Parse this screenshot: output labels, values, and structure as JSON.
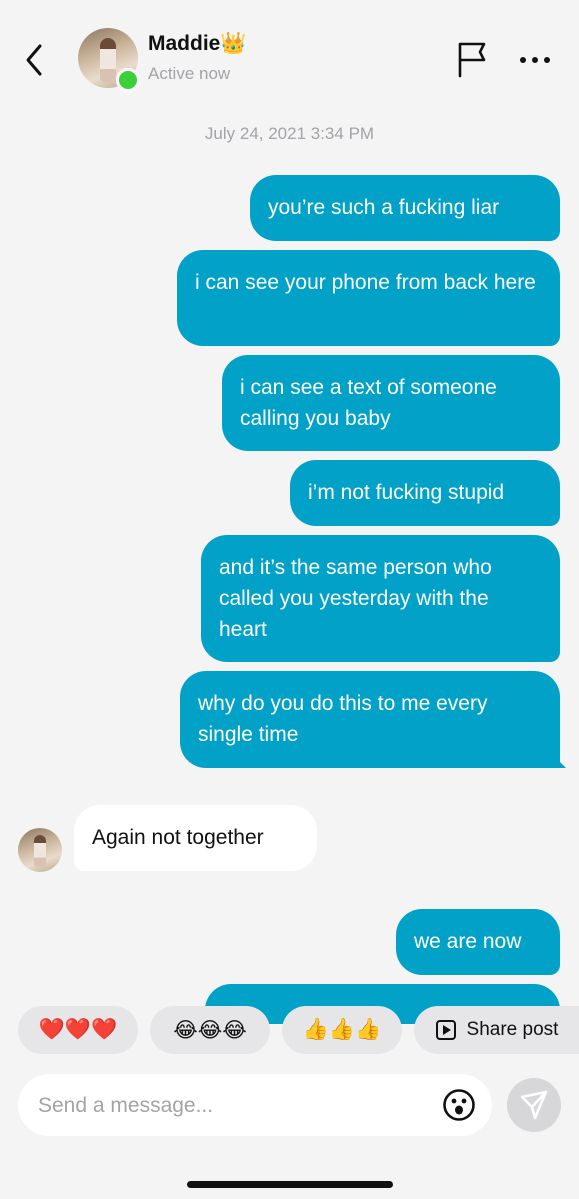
{
  "header": {
    "name": "Maddie",
    "name_emoji": "👑",
    "status": "Active now",
    "icons": [
      "back-chevron-icon",
      "flag-icon",
      "more-icon"
    ]
  },
  "timestamp": "July 24, 2021 3:34 PM",
  "messages": [
    {
      "from": "me",
      "text": "you’re such a fucking liar"
    },
    {
      "from": "me",
      "text": "i can see your phone from back here"
    },
    {
      "from": "me",
      "text": "i can see a text of someone calling you baby"
    },
    {
      "from": "me",
      "text": "i’m not fucking stupid"
    },
    {
      "from": "me",
      "text": "and it’s the same person who called you yesterday with the heart"
    },
    {
      "from": "me",
      "text": "why do you do this to me every single time"
    },
    {
      "from": "them",
      "text": "Again not together"
    },
    {
      "from": "me",
      "text": "we are now"
    }
  ],
  "quick_replies": [
    {
      "label": "❤️❤️❤️"
    },
    {
      "label": "😂😂😂"
    },
    {
      "label": "👍👍👍"
    },
    {
      "label": "Share post",
      "icon": "play-square-icon"
    }
  ],
  "composer": {
    "placeholder": "Send a message...",
    "icons": [
      "emoji-icon",
      "send-icon"
    ]
  },
  "colors": {
    "outgoing_bubble": "#02a2c8",
    "incoming_bubble": "#ffffff",
    "background": "#f4f4f5",
    "online_dot": "#3ad03a"
  }
}
